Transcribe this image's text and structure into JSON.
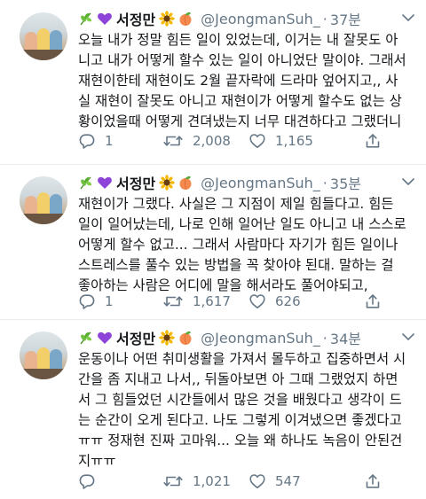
{
  "tweets": [
    {
      "name": "서정만",
      "handle": "@JeongmanSuh_",
      "dot": "·",
      "time": "37분",
      "lines": [
        "오늘 내가 정말 힘든 일이 있었는데, 이거는 내 잘못도 아",
        "니고 내가 어떻게 할수 있는 일이 아니었단 말이야. 그래서",
        "재현이한테 재현이도 2월 끝자락에 드라마 엎어지고,, 사",
        "실 재현이 잘못도 아니고 재현이가 어떻게 할수도 없는 상",
        "황이었을때 어떻게 견뎌냈는지 너무 대견하다고 그랬더니"
      ],
      "replies": "1",
      "retweets": "2,008",
      "likes": "1,165"
    },
    {
      "name": "서정만",
      "handle": "@JeongmanSuh_",
      "dot": "·",
      "time": "35분",
      "lines": [
        "재현이가 그랬다. 사실은 그 지점이 제일 힘들다고. 힘든",
        "일이 일어났는데, 나로 인해 일어난 일도 아니고 내 스스로",
        "어떻게 할수 없고... 그래서 사람마다 자기가 힘든 일이나",
        "스트레스를 풀수 있는 방법을 꼭 찾아야 된대. 말하는 걸",
        "좋아하는 사람은 어디에 말을 해서라도 풀어야되고,"
      ],
      "replies": "1",
      "retweets": "1,617",
      "likes": "626"
    },
    {
      "name": "서정만",
      "handle": "@JeongmanSuh_",
      "dot": "·",
      "time": "34분",
      "lines": [
        "운동이나 어떤 취미생활을 가져서 몰두하고 집중하면서 시",
        "간을 좀 지내고 나서,, 뒤돌아보면 아 그때 그랬었지 하면",
        "서 그 힘들었던 시간들에서 많은 것을 배웠다고 생각이 드",
        "는 순간이 오게 된다고. 나도 그렇게 이겨냈으면 좋겠다고",
        "ㅠㅠ 정재현 진짜 고마워... 오늘 왜 하나도 녹음이 안된건",
        "지ㅠㅠ"
      ],
      "replies": "",
      "retweets": "1,021",
      "likes": "547"
    }
  ],
  "icons": {
    "emoji_1": "herb-emoji-icon",
    "emoji_2": "purple-heart-emoji-icon",
    "emoji_3": "sunflower-emoji-icon",
    "emoji_4": "peach-emoji-icon"
  },
  "colors": {
    "text": "#14171a",
    "secondary": "#657786",
    "divider": "#e6ecf0",
    "heart": "#8e44d9",
    "sunflower": "#f5b800",
    "peach": "#f48a4e"
  }
}
